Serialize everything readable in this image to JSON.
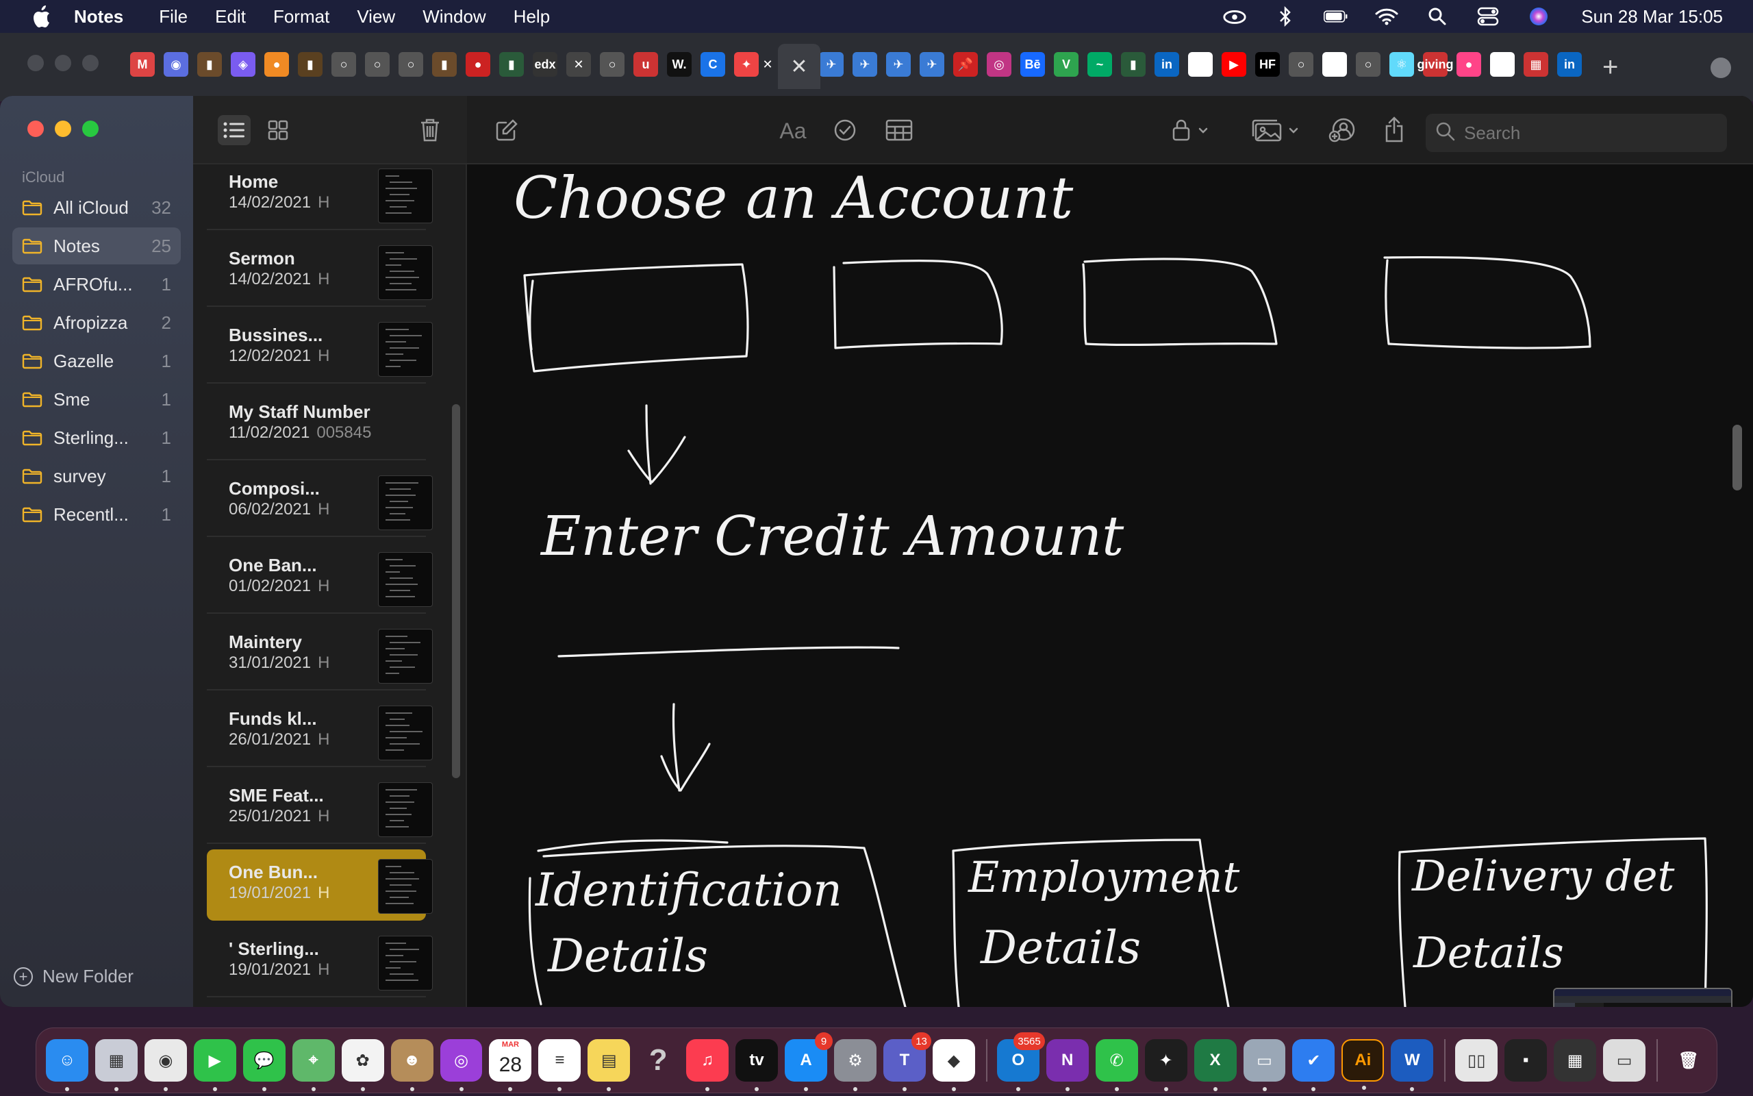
{
  "menubar": {
    "app_name": "Notes",
    "menus": [
      "File",
      "Edit",
      "Format",
      "View",
      "Window",
      "Help"
    ],
    "clock": "Sun 28 Mar  15:05"
  },
  "sidebar": {
    "section": "iCloud",
    "folders": [
      {
        "name": "All iCloud",
        "count": "32"
      },
      {
        "name": "Notes",
        "count": "25"
      },
      {
        "name": "AFROfu...",
        "count": "1"
      },
      {
        "name": "Afropizza",
        "count": "2"
      },
      {
        "name": "Gazelle",
        "count": "1"
      },
      {
        "name": "Sme",
        "count": "1"
      },
      {
        "name": "Sterling...",
        "count": "1"
      },
      {
        "name": "survey",
        "count": "1"
      },
      {
        "name": "Recentl...",
        "count": "1"
      }
    ],
    "new_folder": "New Folder"
  },
  "notes": [
    {
      "title": "Home",
      "date": "14/02/2021",
      "preview": "H"
    },
    {
      "title": "Sermon",
      "date": "14/02/2021",
      "preview": "H"
    },
    {
      "title": "Bussines...",
      "date": "12/02/2021",
      "preview": "H"
    },
    {
      "title": "My Staff Number",
      "date": "11/02/2021",
      "preview": "005845"
    },
    {
      "title": "Composi...",
      "date": "06/02/2021",
      "preview": "H"
    },
    {
      "title": "One Ban...",
      "date": "01/02/2021",
      "preview": "H"
    },
    {
      "title": "Maintery",
      "date": "31/01/2021",
      "preview": "H"
    },
    {
      "title": "Funds kl...",
      "date": "26/01/2021",
      "preview": "H"
    },
    {
      "title": "SME Feat...",
      "date": "25/01/2021",
      "preview": "H"
    },
    {
      "title": "One Bun...",
      "date": "19/01/2021",
      "preview": "H"
    },
    {
      "title": "' Sterling...",
      "date": "19/01/2021",
      "preview": "H"
    }
  ],
  "editor": {
    "format_label": "Aa",
    "search_placeholder": "Search",
    "handwriting": {
      "heading": "Choose an Account",
      "prompt": "Enter Credit Amount",
      "card1_line1": "Identification",
      "card1_line2": "Details",
      "card2_line1": "Employment",
      "card2_line2": "Details",
      "card3_line1": "Delivery det",
      "card3_line2": "Details"
    }
  },
  "tabstrip": {
    "favicons": [
      "M",
      "◉",
      "▮",
      "◈",
      "●",
      "▮",
      "○",
      "○",
      "○",
      "▮",
      "●",
      "▮",
      "edx",
      "✕",
      "○",
      "u",
      "W.",
      "C",
      "✦",
      "✕",
      "✈",
      "✈",
      "✈",
      "✈",
      "📌",
      "◎",
      "Bē",
      "V",
      "~",
      "▮",
      "in",
      "G",
      "▶",
      "HF",
      "○",
      "G",
      "○",
      "⚛",
      "giving",
      "●",
      "G",
      "▦",
      "in"
    ],
    "new_tab": "+"
  },
  "dock": {
    "apps": [
      {
        "name": "finder",
        "label": "☺",
        "color": "#2a8cf0"
      },
      {
        "name": "launchpad",
        "label": "▦",
        "color": "#c9ccd6"
      },
      {
        "name": "chrome",
        "label": "◉",
        "color": "#e9e9e9"
      },
      {
        "name": "facetime",
        "label": "▶",
        "color": "#2fc24a"
      },
      {
        "name": "messages",
        "label": "💬",
        "color": "#2fc24a"
      },
      {
        "name": "maps",
        "label": "⌖",
        "color": "#5fb86a"
      },
      {
        "name": "photos",
        "label": "✿",
        "color": "#f3f3f3"
      },
      {
        "name": "contacts",
        "label": "☻",
        "color": "#b58d5a"
      },
      {
        "name": "podcasts",
        "label": "◎",
        "color": "#9b3fd9"
      },
      {
        "name": "calendar",
        "label": "28",
        "month": "MAR",
        "color": "#ffffff"
      },
      {
        "name": "reminders",
        "label": "≡",
        "color": "#ffffff"
      },
      {
        "name": "notes",
        "label": "▤",
        "color": "#f6d65a"
      },
      {
        "name": "help",
        "label": "?",
        "color": "transparent"
      },
      {
        "name": "music",
        "label": "♫",
        "color": "#fc3c50"
      },
      {
        "name": "tv",
        "label": "tv",
        "color": "#111111"
      },
      {
        "name": "app-store",
        "label": "A",
        "color": "#1a8cf5",
        "badge": "9"
      },
      {
        "name": "system-preferences",
        "label": "⚙",
        "color": "#8b8e96"
      },
      {
        "name": "teams",
        "label": "T",
        "color": "#5b5fc7",
        "badge": "13"
      },
      {
        "name": "affinity",
        "label": "◆",
        "color": "#ffffff"
      },
      {
        "name": "outlook",
        "label": "O",
        "color": "#1679d1",
        "badge": "3565"
      },
      {
        "name": "onenote",
        "label": "N",
        "color": "#7a2eae"
      },
      {
        "name": "whatsapp",
        "label": "✆",
        "color": "#2fc24a"
      },
      {
        "name": "figma",
        "label": "✦",
        "color": "#1e1e1e"
      },
      {
        "name": "excel",
        "label": "X",
        "color": "#1f7a44"
      },
      {
        "name": "preview",
        "label": "▭",
        "color": "#9aa7b6"
      },
      {
        "name": "tasks",
        "label": "✔",
        "color": "#2d7df0"
      },
      {
        "name": "illustrator",
        "label": "Ai",
        "color": "#2b1a08"
      },
      {
        "name": "word",
        "label": "W",
        "color": "#1c5cbf"
      },
      {
        "name": "recent-1",
        "label": "▯▯",
        "color": "#e6e6e6"
      },
      {
        "name": "recent-2",
        "label": "▪",
        "color": "#222"
      },
      {
        "name": "recent-3",
        "label": "▦",
        "color": "#333"
      },
      {
        "name": "recent-4",
        "label": "▭",
        "color": "#ddd"
      },
      {
        "name": "trash",
        "label": "🗑",
        "color": "transparent"
      }
    ]
  },
  "colors": {
    "accent_selected_note": "#b08a14",
    "menubar_bg": "#1c1f3a",
    "ink": "#f2f2f2"
  }
}
